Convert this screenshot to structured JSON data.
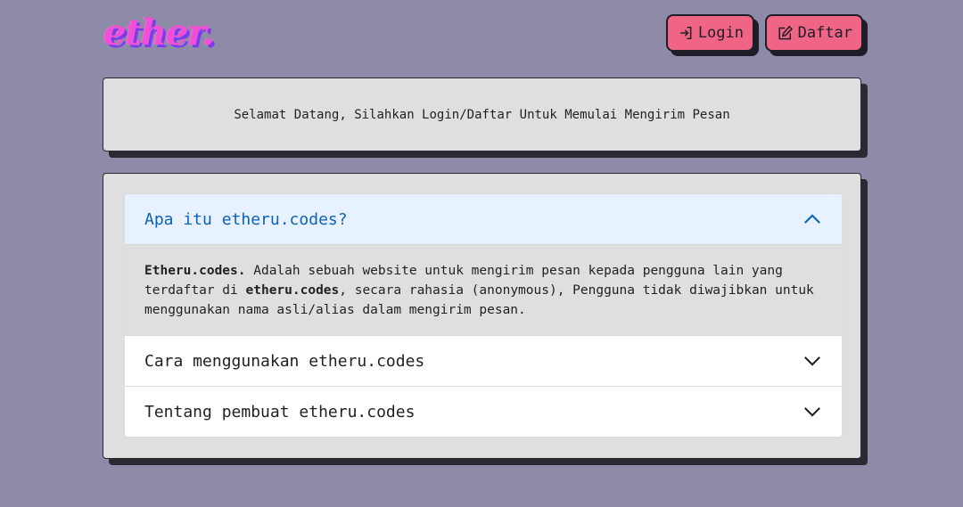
{
  "header": {
    "logo_text": "ether.",
    "login_label": "Login",
    "register_label": "Daftar",
    "accent_color": "#f06585"
  },
  "welcome": {
    "message": "Selamat Datang, Silahkan Login/Daftar Untuk Memulai Mengirim Pesan"
  },
  "faq": [
    {
      "question": "Apa itu etheru.codes?",
      "expanded": true,
      "answer": {
        "lead_bold": "Etheru.codes.",
        "text_1": " Adalah sebuah website untuk mengirim pesan kepada pengguna lain yang terdaftar di ",
        "inline_bold": "etheru.codes",
        "text_2": ", secara rahasia (anonymous), Pengguna tidak diwajibkan untuk menggunakan nama asli/alias dalam mengirim pesan."
      }
    },
    {
      "question": "Cara menggunakan etheru.codes",
      "expanded": false
    },
    {
      "question": "Tentang pembuat etheru.codes",
      "expanded": false
    }
  ],
  "icons": {
    "login": "login-icon",
    "register": "edit-icon",
    "expand": "chevron-down-icon",
    "collapse": "chevron-up-icon"
  }
}
